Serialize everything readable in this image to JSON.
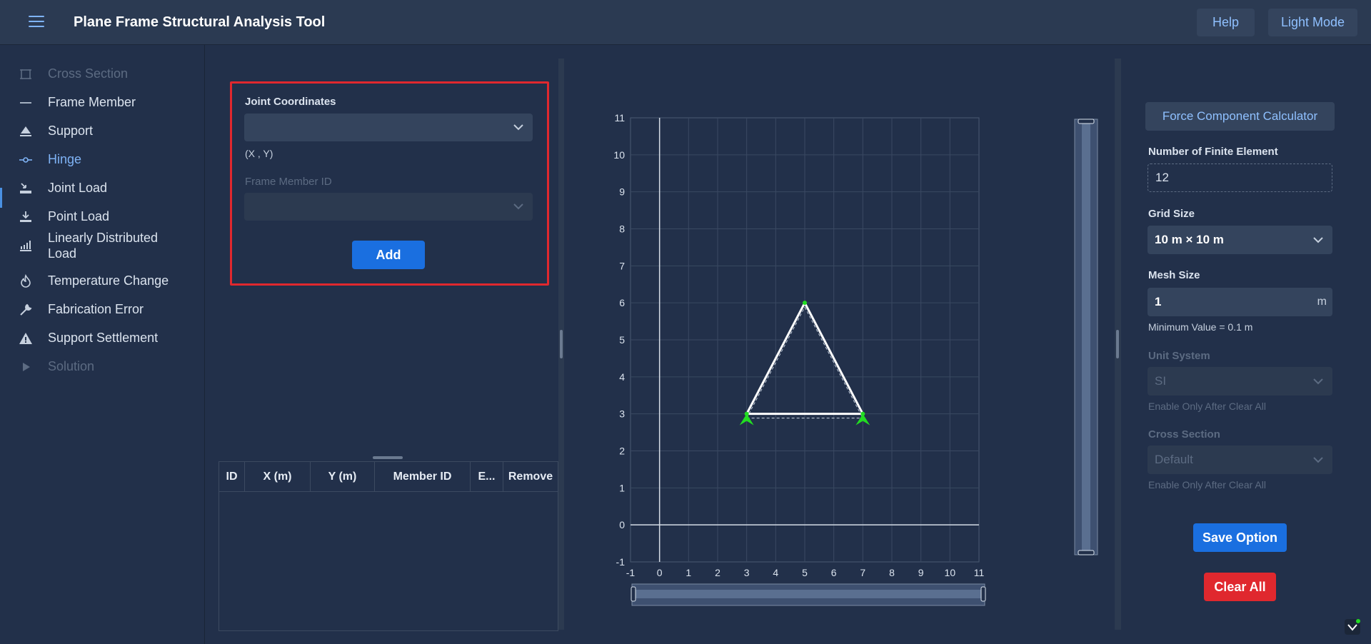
{
  "header": {
    "title": "Plane Frame Structural Analysis Tool",
    "help_label": "Help",
    "theme_label": "Light Mode"
  },
  "sidebar": {
    "items": [
      {
        "label": "Cross Section",
        "icon": "cross-section-icon",
        "state": "disabled"
      },
      {
        "label": "Frame Member",
        "icon": "line-icon",
        "state": "normal"
      },
      {
        "label": "Support",
        "icon": "support-icon",
        "state": "normal"
      },
      {
        "label": "Hinge",
        "icon": "hinge-icon",
        "state": "active"
      },
      {
        "label": "Joint Load",
        "icon": "joint-load-icon",
        "state": "normal"
      },
      {
        "label": "Point Load",
        "icon": "point-load-icon",
        "state": "normal"
      },
      {
        "label": "Linearly Distributed",
        "label2": "Load",
        "icon": "distributed-load-icon",
        "state": "normal"
      },
      {
        "label": "Temperature Change",
        "icon": "fire-icon",
        "state": "normal"
      },
      {
        "label": "Fabrication Error",
        "icon": "wrench-icon",
        "state": "normal"
      },
      {
        "label": "Support Settlement",
        "icon": "warning-icon",
        "state": "normal"
      },
      {
        "label": "Solution",
        "icon": "play-icon",
        "state": "disabled"
      }
    ]
  },
  "form": {
    "joint_label": "Joint Coordinates",
    "joint_value": "",
    "joint_hint": "(X , Y)",
    "member_label": "Frame Member ID",
    "member_value": "",
    "add_label": "Add"
  },
  "table": {
    "columns": [
      "ID",
      "X (m)",
      "Y (m)",
      "Member ID",
      "E...",
      "Remove"
    ],
    "rows": []
  },
  "plot": {
    "x_ticks": [
      "-1",
      "0",
      "1",
      "2",
      "3",
      "4",
      "5",
      "6",
      "7",
      "8",
      "9",
      "10",
      "11"
    ],
    "y_ticks": [
      "-1",
      "0",
      "1",
      "2",
      "3",
      "4",
      "5",
      "6",
      "7",
      "8",
      "9",
      "10",
      "11"
    ],
    "xlim": [
      -1,
      11
    ],
    "ylim": [
      -1,
      11
    ],
    "joints": [
      [
        3,
        3
      ],
      [
        5,
        6
      ],
      [
        7,
        3
      ]
    ],
    "members": [
      [
        [
          3,
          3
        ],
        [
          5,
          6
        ]
      ],
      [
        [
          5,
          6
        ],
        [
          7,
          3
        ]
      ],
      [
        [
          3,
          3
        ],
        [
          7,
          3
        ]
      ]
    ],
    "supports": [
      [
        3,
        3
      ],
      [
        7,
        3
      ]
    ],
    "colors": {
      "member": "#ffffff",
      "support": "#22dd22",
      "grid": "#3a4962",
      "axis": "#d5dce6"
    }
  },
  "settings": {
    "force_calc_label": "Force Component Calculator",
    "fe_label": "Number of Finite Element",
    "fe_value": "12",
    "grid_label": "Grid Size",
    "grid_value": "10 m × 10 m",
    "mesh_label": "Mesh Size",
    "mesh_value": "1",
    "mesh_unit": "m",
    "mesh_hint": "Minimum Value = 0.1 m",
    "unit_label": "Unit System",
    "unit_value": "SI",
    "unit_hint": "Enable Only After Clear All",
    "cs_label": "Cross Section",
    "cs_value": "Default",
    "cs_hint": "Enable Only After Clear All",
    "save_label": "Save Option",
    "clear_label": "Clear All"
  }
}
